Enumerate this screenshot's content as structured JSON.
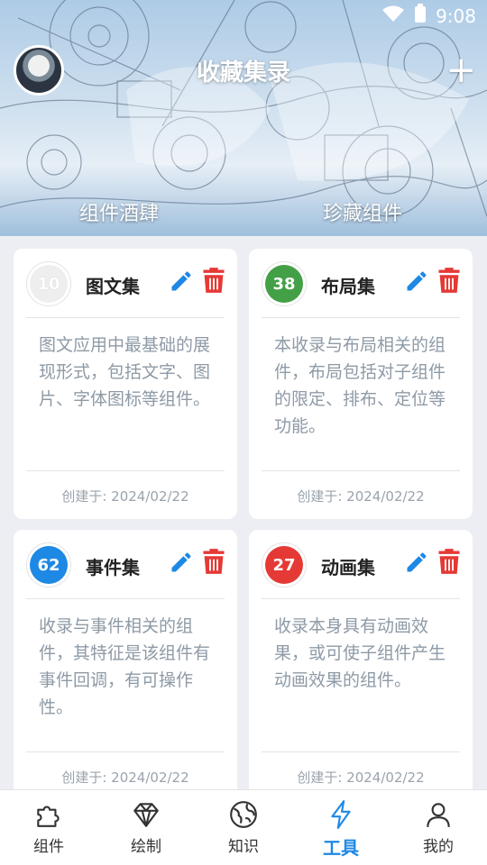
{
  "status": {
    "time": "9:08"
  },
  "header": {
    "title": "收藏集录",
    "add_label": "+",
    "tabs": [
      "组件酒肆",
      "珍藏组件"
    ]
  },
  "cards": [
    {
      "count": "10",
      "name": "图文集",
      "color": "#eeeeee",
      "count_color": "#ffffff",
      "desc": "图文应用中最基础的展现形式，包括文字、图片、字体图标等组件。",
      "date": "创建于: 2024/02/22"
    },
    {
      "count": "38",
      "name": "布局集",
      "color": "#43a047",
      "count_color": "#ffffff",
      "desc": "本收录与布局相关的组件，布局包括对子组件的限定、排布、定位等功能。",
      "date": "创建于: 2024/02/22"
    },
    {
      "count": "62",
      "name": "事件集",
      "color": "#1e88e5",
      "count_color": "#ffffff",
      "desc": "收录与事件相关的组件，其特征是该组件有事件回调，有可操作性。",
      "date": "创建于: 2024/02/22"
    },
    {
      "count": "27",
      "name": "动画集",
      "color": "#e53935",
      "count_color": "#ffffff",
      "desc": "收录本身具有动画效果，或可使子组件产生动画效果的组件。",
      "date": "创建于: 2024/02/22"
    }
  ],
  "nav": {
    "items": [
      {
        "label": "组件",
        "icon": "puzzle-icon"
      },
      {
        "label": "绘制",
        "icon": "diamond-icon"
      },
      {
        "label": "知识",
        "icon": "globe-icon"
      },
      {
        "label": "工具",
        "icon": "lightning-icon",
        "active": true
      },
      {
        "label": "我的",
        "icon": "person-icon"
      }
    ]
  },
  "colors": {
    "edit": "#1e88e5",
    "delete": "#e53935",
    "active_tab": "#1e88e5"
  }
}
